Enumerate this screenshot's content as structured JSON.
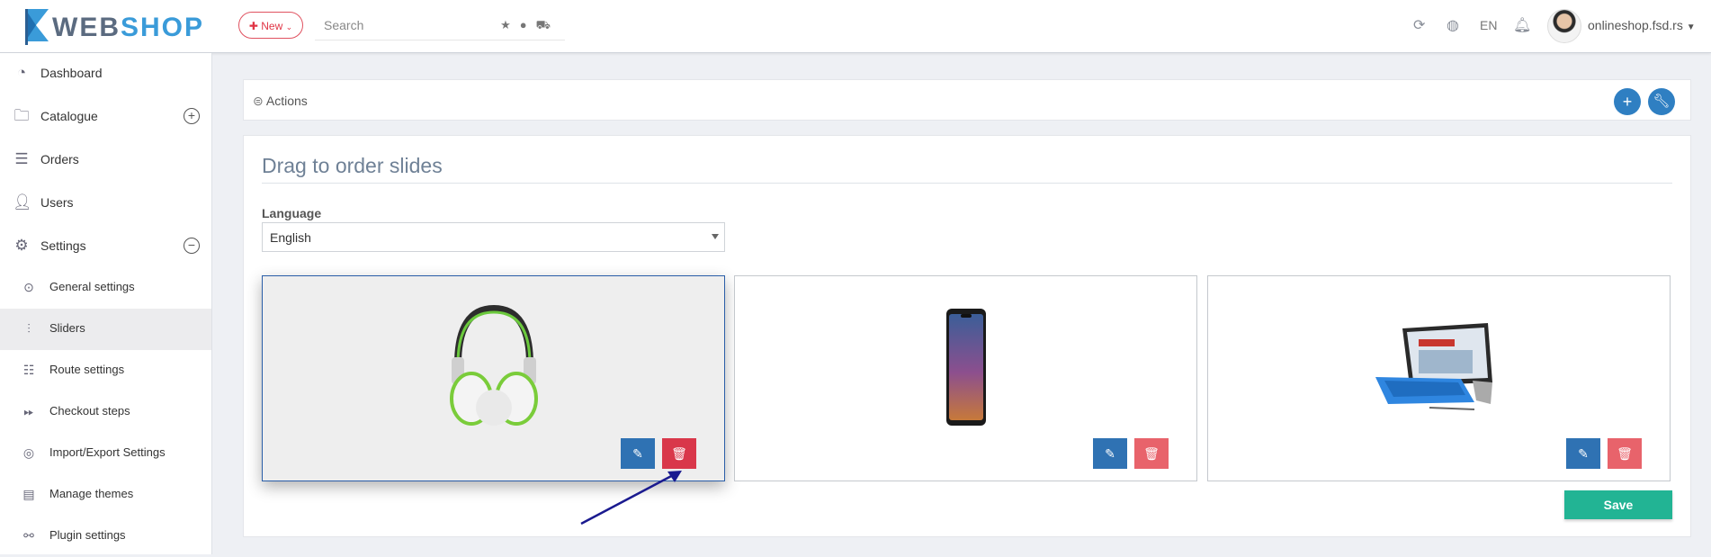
{
  "brand": {
    "name": "WEBSHOP",
    "accent": "#3a9bd9"
  },
  "topbar": {
    "new_label": "New",
    "search_placeholder": "Search",
    "language_code": "EN",
    "account": "onlineshop.fsd.rs"
  },
  "sidebar": {
    "items": [
      {
        "label": "Dashboard"
      },
      {
        "label": "Catalogue"
      },
      {
        "label": "Orders"
      },
      {
        "label": "Users"
      },
      {
        "label": "Settings"
      }
    ],
    "settings_sub": [
      {
        "label": "General settings"
      },
      {
        "label": "Sliders"
      },
      {
        "label": "Route settings"
      },
      {
        "label": "Checkout steps"
      },
      {
        "label": "Import/Export Settings"
      },
      {
        "label": "Manage themes"
      },
      {
        "label": "Plugin settings"
      }
    ]
  },
  "actions": {
    "label": "Actions"
  },
  "main": {
    "title": "Drag to order slides",
    "language_label": "Language",
    "language_value": "English",
    "save_label": "Save"
  },
  "colors": {
    "edit": "#2f72b3",
    "delete": "#e8636b",
    "save": "#22b494"
  }
}
